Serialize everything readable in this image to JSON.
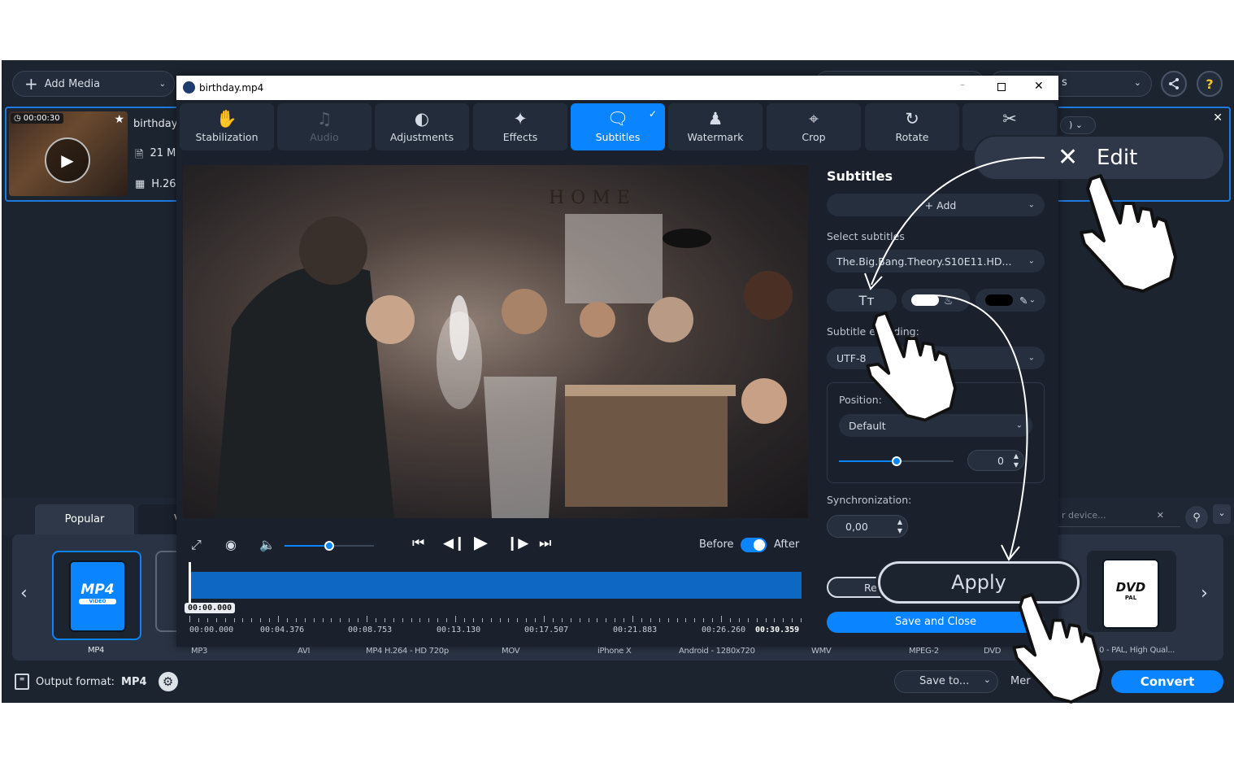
{
  "main": {
    "add_media": "Add Media",
    "dropdown_partial": "s",
    "help": "?",
    "media": {
      "duration": "00:00:30",
      "name": "birthday",
      "size": "21 M",
      "codec": "H.26"
    },
    "edit_button": "Edit",
    "format_tabs": [
      "Popular",
      "V"
    ],
    "device_search_placeholder": "r device...",
    "formats": [
      "MP4",
      "MP3",
      "AVI",
      "MP4 H.264 - HD 720p",
      "MOV",
      "iPhone X",
      "Android - 1280x720",
      "WMV",
      "MPEG-2",
      "DVD",
      "0 - PAL, High Qual..."
    ],
    "mp4_icon_text": "MP4",
    "mp4_icon_sub": "VIDEO",
    "dvd_icon_text": "DVD",
    "dvd_icon_sub": "PAL",
    "output_label": "Output format:",
    "output_value": "MP4",
    "save_to": "Save to...",
    "merge_partial": "Mer",
    "convert": "Convert"
  },
  "dialog": {
    "title": "birthday.mp4",
    "tabs": [
      {
        "label": "Stabilization",
        "icon": "hand-icon"
      },
      {
        "label": "Audio",
        "icon": "music-icon"
      },
      {
        "label": "Adjustments",
        "icon": "contrast-icon"
      },
      {
        "label": "Effects",
        "icon": "magic-wand-icon"
      },
      {
        "label": "Subtitles",
        "icon": "speech-bubble-icon"
      },
      {
        "label": "Watermark",
        "icon": "stamp-icon"
      },
      {
        "label": "Crop",
        "icon": "crop-icon"
      },
      {
        "label": "Rotate",
        "icon": "rotate-icon"
      },
      {
        "label": "",
        "icon": "scissors-icon"
      }
    ],
    "video_sign": "HOME",
    "player": {
      "before": "Before",
      "after": "After",
      "playhead_time": "00:00.000",
      "volume_level": 0.5
    },
    "timeline_labels": [
      "00:00.000",
      "00:04.376",
      "00:08.753",
      "00:13.130",
      "00:17.507",
      "00:21.883",
      "00:26.260",
      "00:30.359"
    ],
    "panel": {
      "heading": "Subtitles",
      "add": "Add",
      "select_label": "Select subtitles",
      "select_value": "The.Big.Bang.Theory.S10E11.HD...",
      "font_btn": "Tт",
      "encoding_label": "Subtitle encoding:",
      "encoding_value": "UTF-8",
      "position_label": "Position:",
      "position_value": "Default",
      "position_slider_level": 0.5,
      "position_number": "0",
      "sync_label": "Synchronization:",
      "sync_value": "0,00",
      "reset_partial": "Re",
      "apply": "Apply",
      "save_close": "Save and Close"
    }
  },
  "colors": {
    "accent": "#0a84ff",
    "bg": "#1c2430",
    "dialog": "#1a212d"
  }
}
